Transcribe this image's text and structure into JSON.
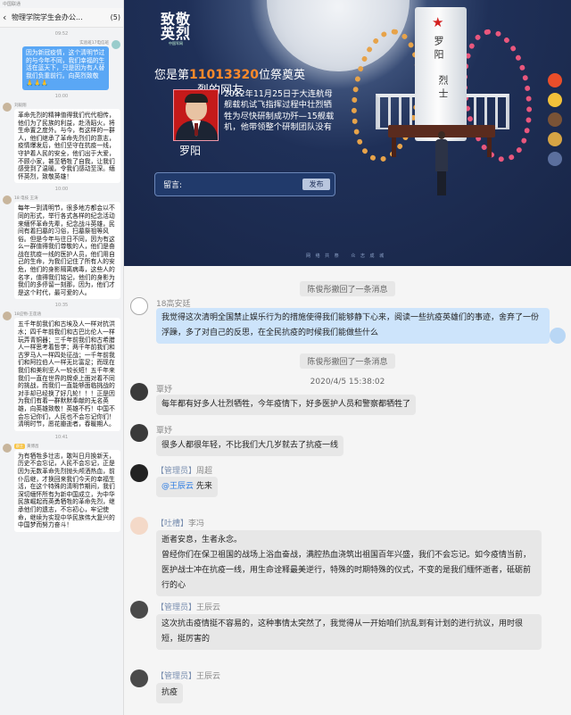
{
  "left_chat": {
    "status_text": "中国联通",
    "back_glyph": "‹",
    "title": "物理学院学生会办公...",
    "member_count": "(5)",
    "messages": [
      {
        "type": "time",
        "text": "09:52"
      },
      {
        "type": "self",
        "name": "实验班17电信班",
        "text": "因为新冠疫情，这个清明节过的与今年不同，我们幸福的生活在蓝天下，只是因为有人替我们负重前行。向英烈致敬🙏🙏🙏"
      },
      {
        "type": "time",
        "text": "10:00"
      },
      {
        "type": "other",
        "name": "刘毅翔",
        "text": "革命先烈的精神值得我们代代相传，他们为了民族的利益，赴汤蹈火，将生命置之度外。与今，有这样的一群人，他们继承了革命先烈们的意志，疫情爆发后，他们坚守在抗疫一线，守护着人民的安全，他们出于大爱，不顾小家，甚至牺牲了自我，让我们感受到了温暖。令我们感动至深。缅怀英烈，致敬英雄！"
      },
      {
        "type": "time",
        "text": "10:00"
      },
      {
        "type": "other",
        "name": "18 电技 王涛",
        "text": "每年一到清明节，很多地方都会以不同的形式，举行各式各样的纪念活动来缅怀革命先辈，纪念战斗英雄，民间有着扫墓的习俗，扫墓祭祖等风俗。但是今年与往日不同，因为有这么一群值得我们尊敬的人，他们是奋战在抗疫一线的医护人员，他们用自己的生命，为我们记住了所有人的安危，他们的身影隔离病毒，这些人的名字，值得我们铭记，他们的身影为我们的多停留一刻那，因为，他们才是这个时代，最可爱的人。"
      },
      {
        "type": "time",
        "text": "10:35"
      },
      {
        "type": "other",
        "name": "18应物-王莲涵",
        "text": "五千年前我们和古埃及人一样对抗洪水；四千年前我们和古巴比伦人一样玩弄青铜器；三千年前我们和古希腊人一样思考着哲学；两千年前我们和古罗马人一样四处征战；一千年前我们和阿拉伯人一样无比富足；而现在我们和美利坚人一较长短！五千年来我们一直在世界的牌桌上面对着不同的挑战，而我们一直能够面临挑战的对手却已经换了好几轮！！！正是因为我们有着一群默默奉献的无名英雄，向英雄致敬！英雄不朽！中国不会忘记你们，人民也不会忘记你们！清明时节，愿花瓣逝者，春暖期人。"
      },
      {
        "type": "time",
        "text": "10:41"
      },
      {
        "type": "other",
        "name": "黄博昌",
        "tag": "群主",
        "text": "为有牺牲多壮志，敢叫日月换新天，历史不会忘记，人民不会忘记，正是因为无数革命先烈抛头颅洒热血，前仆后继，才换回来我们今天的幸福生活，在这个特殊的清明节期间，我们深切缅怀所有为新中国成立，为中华民族崛起而英勇牺牲的革命先烈，继承他们的遗志，不忘初心，牢记使命，继续为实现中华民族伟大复兴的中国梦而努力奋斗！"
      }
    ]
  },
  "memorial": {
    "logo_big": "致敬英烈",
    "logo_small": "中国军网",
    "counter_prefix": "您是第",
    "counter_number": "11013320",
    "counter_suffix": "位祭奠英",
    "counter_line2": "烈的网友",
    "hero_name": "罗阳",
    "bio": "2012年11月25日于大连航母舰载机试飞指挥过程中壮烈牺牲为尽快研制成功歼—15舰载机，他带领整个研制团队没有",
    "message_label": "留言:",
    "message_placeholder": "",
    "send_label": "发布",
    "monument_star": "★",
    "monument_name": "罗阳",
    "monument_title": "烈士",
    "footer_items": [
      "网 络 共 祭",
      "众 志 成 城"
    ]
  },
  "group_chat": {
    "recall_1": "陈俊彤撤回了一条消息",
    "recall_2": "陈俊彤撤回了一条消息",
    "timestamp": "2020/4/5 15:38:02",
    "messages": [
      {
        "name": "18高安廷",
        "role": "",
        "text": "我觉得这次清明全国禁止娱乐行为的措施使得我们能够静下心来，阅读一些抗疫英雄们的事迹，舍弃了一份浮躁，多了对自己的反思，在全民抗疫的时候我们能做些什么"
      },
      {
        "name": "覃妤",
        "role": "",
        "text": "每年都有好多人壮烈牺牲，今年疫情下，好多医护人员和警察都牺牲了"
      },
      {
        "name": "覃妤",
        "role": "",
        "text": "很多人都很年轻，不比我们大几岁就去了抗疫一线"
      },
      {
        "name": "周超",
        "role": "【管理员】",
        "mention": "@王辰云",
        "text": " 先来"
      },
      {
        "name": "李冯",
        "role": "【吐槽】",
        "text": "逝者安息，生者永念。\n曾经你们在保卫祖国的战场上浴血奋战，满腔热血浇筑出祖国百年兴盛，我们不会忘记。如今疫情当前，医护战士冲在抗疫一线，用生命诠释最美逆行，特殊的时期特殊的仪式，不变的是我们缅怀逝者，砥砺前行的心"
      },
      {
        "name": "王辰云",
        "role": "【管理员】",
        "text": "这次抗击疫情挺不容易的，这种事情太突然了，我觉得从一开始咱们抗乱到有计划的进行抗议，用时很短，挺厉害的"
      },
      {
        "name": "王辰云",
        "role": "【管理员】",
        "text": "抗疫"
      }
    ]
  }
}
